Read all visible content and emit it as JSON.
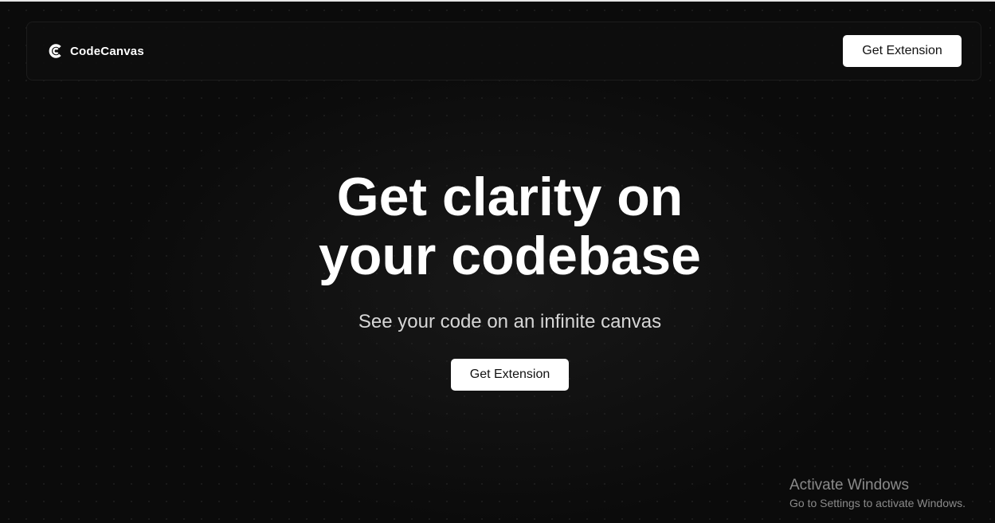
{
  "brand": {
    "icon": "codecanvas-logo-icon",
    "name": "CodeCanvas"
  },
  "nav": {
    "cta_label": "Get Extension"
  },
  "hero": {
    "title_line1": "Get clarity on",
    "title_line2": "your codebase",
    "subtitle": "See your code on an infinite canvas",
    "cta_label": "Get Extension"
  },
  "watermark": {
    "title": "Activate Windows",
    "subtitle": "Go to Settings to activate Windows."
  },
  "colors": {
    "background": "#0b0b0b",
    "button_bg": "#ffffff",
    "button_text": "#111111",
    "text_primary": "#ffffff",
    "text_secondary": "#d6d6d6"
  }
}
